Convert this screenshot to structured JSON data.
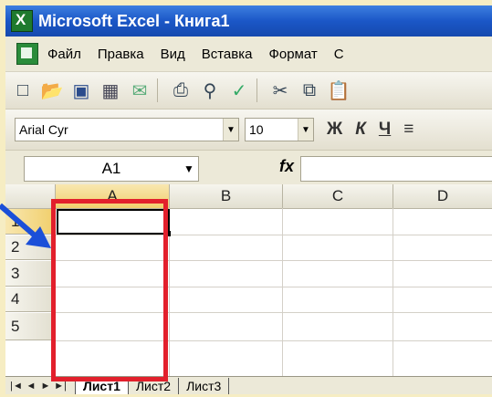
{
  "window": {
    "title": "Microsoft Excel - Книга1"
  },
  "menu": {
    "items": [
      "Файл",
      "Правка",
      "Вид",
      "Вставка",
      "Формат",
      "С"
    ]
  },
  "toolbar": {
    "icons": [
      "new-icon",
      "open-icon",
      "save-icon",
      "permission-icon",
      "email-icon",
      "print-icon",
      "print-preview-icon",
      "spellcheck-icon",
      "cut-icon",
      "copy-icon",
      "paste-icon"
    ]
  },
  "format": {
    "font_name": "Arial Cyr",
    "font_size": "10",
    "bold": "Ж",
    "italic": "К",
    "underline": "Ч"
  },
  "formula_bar": {
    "name_box": "A1",
    "fx": "fx",
    "value": ""
  },
  "grid": {
    "columns": [
      "A",
      "B",
      "C",
      "D"
    ],
    "rows": [
      "1",
      "2",
      "3",
      "4",
      "5"
    ]
  },
  "sheets": {
    "nav": [
      "|◄",
      "◄",
      "►",
      "►|"
    ],
    "tabs": [
      "Лист1",
      "Лист2",
      "Лист3"
    ],
    "active": "Лист1"
  },
  "colors": {
    "highlight": "#e2202c",
    "titlebar": "#1b57c7"
  }
}
